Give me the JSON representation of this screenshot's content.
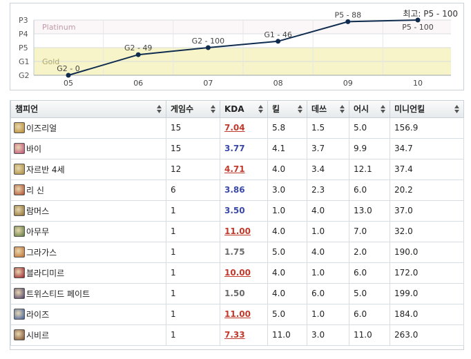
{
  "rank_chart": {
    "best_label": "최고: P5 - 100",
    "y_ticks": [
      "P3",
      "P4",
      "P5",
      "G1",
      "G2"
    ],
    "tier_bands": [
      {
        "name": "Platinum",
        "color": "#fbf6f8"
      },
      {
        "name": "Gold",
        "color": "#f6f4c8"
      }
    ],
    "x_ticks": [
      "05",
      "06",
      "07",
      "08",
      "09",
      "10"
    ]
  },
  "chart_data": {
    "type": "line",
    "x": [
      "05",
      "06",
      "07",
      "08",
      "09",
      "10"
    ],
    "series": [
      {
        "values": [
          0,
          1.49,
          2.0,
          2.46,
          3.88,
          4.0
        ],
        "point_labels": [
          "G2 - 0",
          "G2 - 49",
          "G2 - 100",
          "G1 - 46",
          "P5 - 88",
          "P5 - 100"
        ]
      }
    ],
    "y_tick_labels": [
      "G2",
      "G1",
      "P5",
      "P4",
      "P3"
    ],
    "ylim": [
      0,
      6
    ],
    "grid": true,
    "line_color": "#0f2b4e"
  },
  "table": {
    "headers": [
      "챔피언",
      "게임수",
      "KDA",
      "킬",
      "데쓰",
      "어시",
      "미니언킬"
    ],
    "rows": [
      {
        "champ": "이즈리얼",
        "games": "15",
        "kda": "7.04",
        "kda_style": "red",
        "kills": "5.8",
        "deaths": "1.5",
        "assists": "5.0",
        "cs": "156.9",
        "icon_color": "#b8862a"
      },
      {
        "champ": "바이",
        "games": "15",
        "kda": "3.77",
        "kda_style": "blue",
        "kills": "4.1",
        "deaths": "3.7",
        "assists": "9.9",
        "cs": "34.7",
        "icon_color": "#c04a7a"
      },
      {
        "champ": "자르반 4세",
        "games": "12",
        "kda": "4.71",
        "kda_style": "red",
        "kills": "4.0",
        "deaths": "3.4",
        "assists": "12.1",
        "cs": "37.4",
        "icon_color": "#a88a3a"
      },
      {
        "champ": "리 신",
        "games": "6",
        "kda": "3.86",
        "kda_style": "blue",
        "kills": "3.0",
        "deaths": "2.3",
        "assists": "6.0",
        "cs": "20.2",
        "icon_color": "#b04a2a"
      },
      {
        "champ": "람머스",
        "games": "1",
        "kda": "3.50",
        "kda_style": "blue",
        "kills": "1.0",
        "deaths": "4.0",
        "assists": "13.0",
        "cs": "37.0",
        "icon_color": "#8a6a2a"
      },
      {
        "champ": "아무무",
        "games": "1",
        "kda": "11.00",
        "kda_style": "red",
        "kills": "4.0",
        "deaths": "1.0",
        "assists": "7.0",
        "cs": "32.0",
        "icon_color": "#5a7a3a"
      },
      {
        "champ": "그라가스",
        "games": "1",
        "kda": "1.75",
        "kda_style": "gray",
        "kills": "5.0",
        "deaths": "4.0",
        "assists": "2.0",
        "cs": "190.0",
        "icon_color": "#c06a2a"
      },
      {
        "champ": "블라디미르",
        "games": "1",
        "kda": "10.00",
        "kda_style": "red",
        "kills": "4.0",
        "deaths": "1.0",
        "assists": "6.0",
        "cs": "172.0",
        "icon_color": "#9a1a2a"
      },
      {
        "champ": "트위스티드 페이트",
        "games": "1",
        "kda": "1.50",
        "kda_style": "gray",
        "kills": "4.0",
        "deaths": "6.0",
        "assists": "5.0",
        "cs": "199.0",
        "icon_color": "#4a3a6a"
      },
      {
        "champ": "라이즈",
        "games": "1",
        "kda": "11.00",
        "kda_style": "red",
        "kills": "5.0",
        "deaths": "1.0",
        "assists": "6.0",
        "cs": "184.0",
        "icon_color": "#3a5aa0"
      },
      {
        "champ": "시비르",
        "games": "1",
        "kda": "7.33",
        "kda_style": "red",
        "kills": "11.0",
        "deaths": "3.0",
        "assists": "11.0",
        "cs": "263.0",
        "icon_color": "#7a4a2a"
      }
    ]
  }
}
